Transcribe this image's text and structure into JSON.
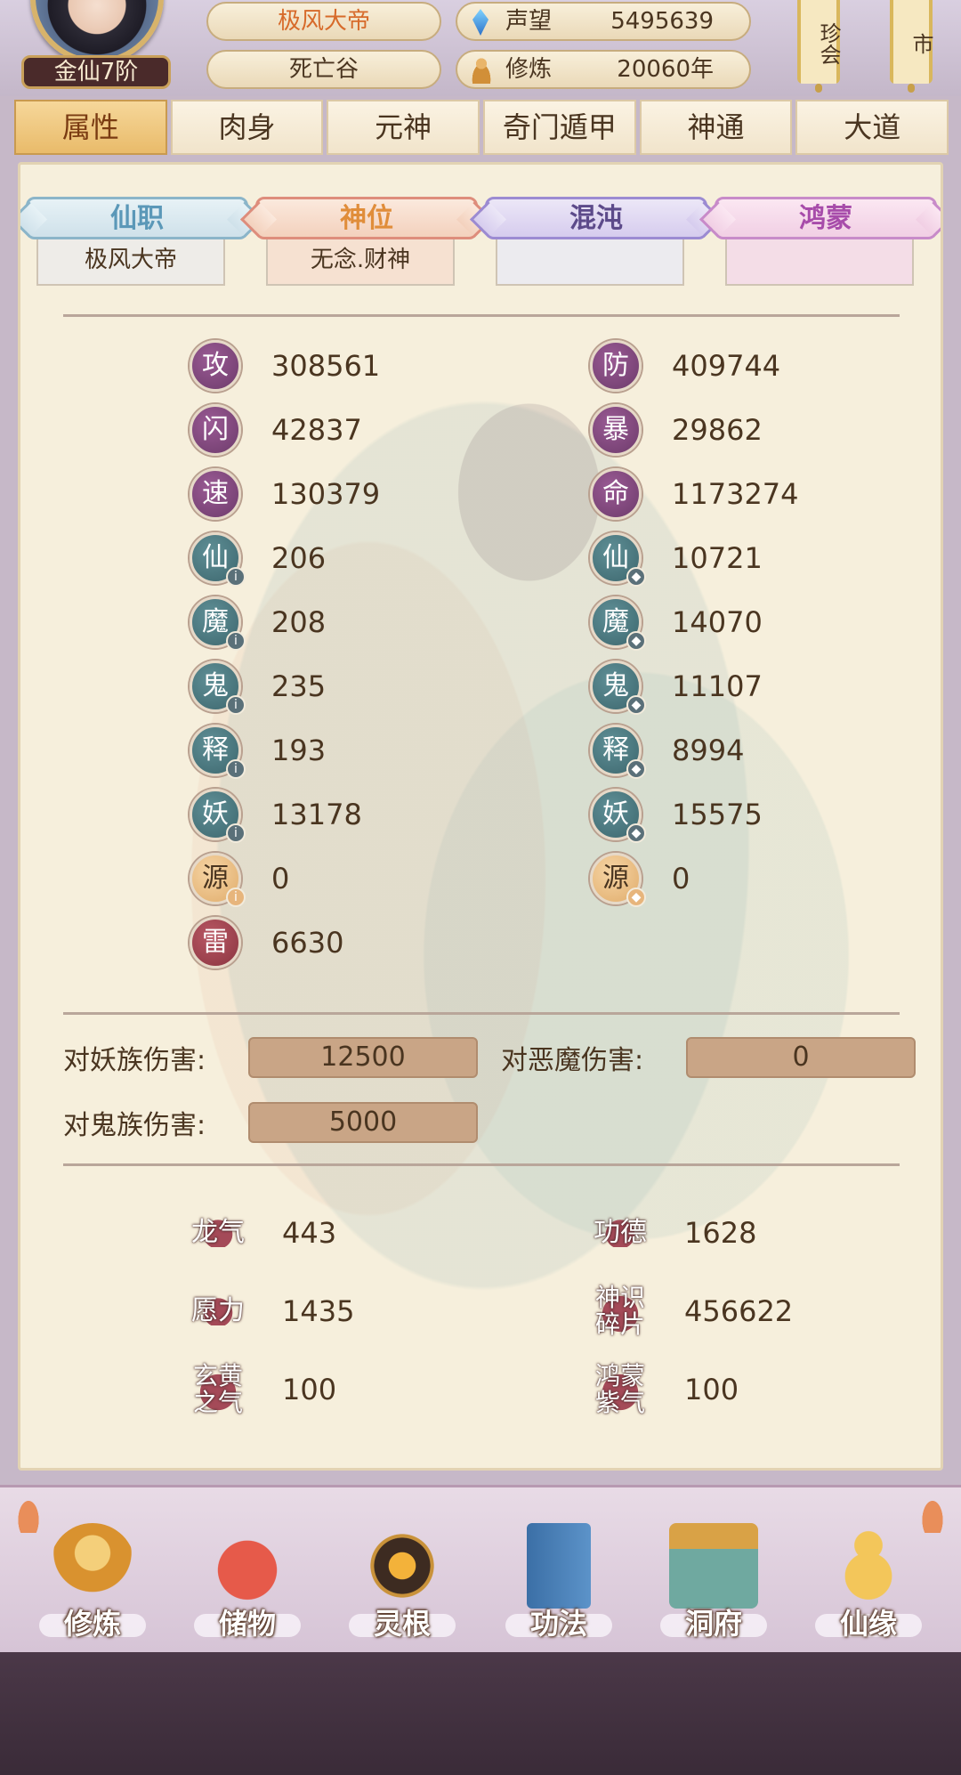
{
  "header": {
    "rank": "金仙7阶",
    "name": "极风大帝",
    "location": "死亡谷",
    "reputation": {
      "label": "声望",
      "value": "5495639"
    },
    "cultivation": {
      "label": "修炼",
      "value": "20060年"
    },
    "scroll_1": "珍会",
    "scroll_2": "市"
  },
  "tabs": [
    "属性",
    "肉身",
    "元神",
    "奇门遁甲",
    "神通",
    "大道"
  ],
  "ranks": [
    {
      "title": "仙职",
      "value": "极风大帝"
    },
    {
      "title": "神位",
      "value": "无念.财神"
    },
    {
      "title": "混沌",
      "value": ""
    },
    {
      "title": "鸿蒙",
      "value": ""
    }
  ],
  "stats_left": [
    {
      "char": "攻",
      "value": "308561",
      "style": "purple"
    },
    {
      "char": "闪",
      "value": "42837",
      "style": "purple"
    },
    {
      "char": "速",
      "value": "130379",
      "style": "purple"
    },
    {
      "char": "仙",
      "value": "206",
      "style": "teal"
    },
    {
      "char": "魔",
      "value": "208",
      "style": "teal"
    },
    {
      "char": "鬼",
      "value": "235",
      "style": "teal"
    },
    {
      "char": "释",
      "value": "193",
      "style": "teal"
    },
    {
      "char": "妖",
      "value": "13178",
      "style": "teal"
    },
    {
      "char": "源",
      "value": "0",
      "style": "gold"
    },
    {
      "char": "雷",
      "value": "6630",
      "style": "red"
    }
  ],
  "stats_right": [
    {
      "char": "防",
      "value": "409744",
      "style": "purple"
    },
    {
      "char": "暴",
      "value": "29862",
      "style": "purple"
    },
    {
      "char": "命",
      "value": "1173274",
      "style": "purple"
    },
    {
      "char": "仙",
      "value": "10721",
      "style": "teal"
    },
    {
      "char": "魔",
      "value": "14070",
      "style": "teal"
    },
    {
      "char": "鬼",
      "value": "11107",
      "style": "teal"
    },
    {
      "char": "释",
      "value": "8994",
      "style": "teal"
    },
    {
      "char": "妖",
      "value": "15575",
      "style": "teal"
    },
    {
      "char": "源",
      "value": "0",
      "style": "gold"
    }
  ],
  "damage": [
    {
      "label": "对妖族伤害:",
      "value": "12500"
    },
    {
      "label": "对恶魔伤害:",
      "value": "0"
    },
    {
      "label": "对鬼族伤害:",
      "value": "5000"
    }
  ],
  "resources": [
    {
      "label": "龙气",
      "value": "443"
    },
    {
      "label": "功德",
      "value": "1628"
    },
    {
      "label": "愿力",
      "value": "1435"
    },
    {
      "label": "神识碎片",
      "value": "456622"
    },
    {
      "label": "玄黄之气",
      "value": "100"
    },
    {
      "label": "鸿蒙紫气",
      "value": "100"
    }
  ],
  "nav": [
    "修炼",
    "储物",
    "灵根",
    "功法",
    "洞府",
    "仙缘"
  ]
}
